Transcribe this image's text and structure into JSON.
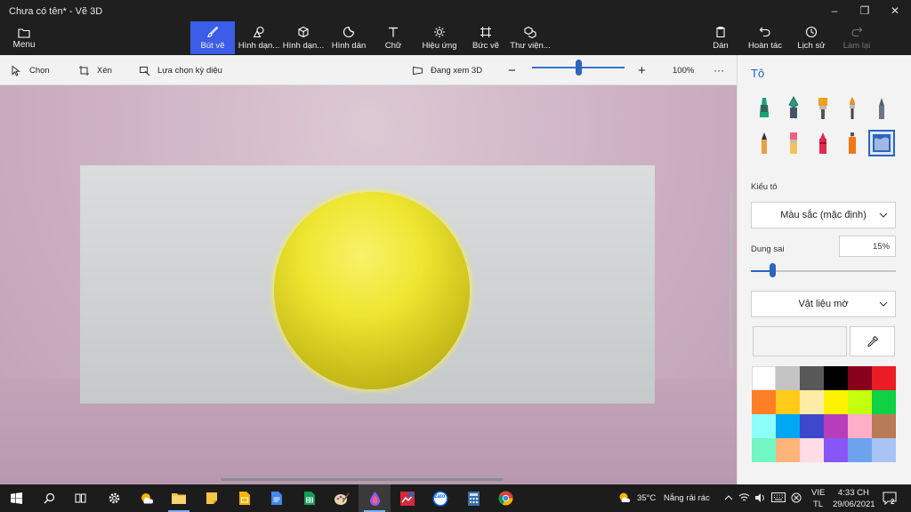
{
  "app": {
    "title": "Chưa có tên* - Vẽ 3D"
  },
  "window_controls": {
    "minimize": "–",
    "maximize": "❐",
    "close": "✕"
  },
  "ribbon": {
    "menu_label": "Menu",
    "tools": [
      {
        "label": "Bút vẽ",
        "icon": "brush-icon",
        "active": true
      },
      {
        "label": "Hình dạn...",
        "icon": "2d-shapes-icon"
      },
      {
        "label": "Hình dạn...",
        "icon": "3d-shapes-icon"
      },
      {
        "label": "Hình dán",
        "icon": "stickers-icon"
      },
      {
        "label": "Chữ",
        "icon": "text-icon"
      },
      {
        "label": "Hiệu ứng",
        "icon": "effects-icon"
      },
      {
        "label": "Bức vẽ",
        "icon": "canvas-icon"
      },
      {
        "label": "Thư viện...",
        "icon": "3d-library-icon"
      }
    ],
    "right_tools": [
      {
        "label": "Dán",
        "icon": "paste-icon"
      },
      {
        "label": "Hoàn tác",
        "icon": "undo-icon"
      },
      {
        "label": "Lịch sử",
        "icon": "history-icon"
      },
      {
        "label": "Làm lại",
        "icon": "redo-icon",
        "disabled": true
      }
    ]
  },
  "toolbar": {
    "select_label": "Chọn",
    "crop_label": "Xén",
    "magic_select_label": "Lựa chọn kỳ diệu",
    "view_3d_label": "Đang xem 3D",
    "zoom_out": "−",
    "zoom_in": "+",
    "zoom_level": "100%",
    "zoom_slider_fraction": 0.5,
    "more": "···"
  },
  "panel": {
    "title": "Tô",
    "brushes": [
      {
        "name": "marker",
        "color": "#1aa37a"
      },
      {
        "name": "calligraphy-pen",
        "color": "#2a9a8a"
      },
      {
        "name": "oil-brush",
        "color": "#f0a020"
      },
      {
        "name": "watercolor",
        "color": "#e89028"
      },
      {
        "name": "pixel-pen",
        "color": "#556070"
      },
      {
        "name": "pencil",
        "color": "#e8a040"
      },
      {
        "name": "eraser",
        "color": "#f06080"
      },
      {
        "name": "crayon",
        "color": "#e02850"
      },
      {
        "name": "spray-can",
        "color": "#f07818"
      },
      {
        "name": "fill",
        "color": "#2d64bf",
        "selected": true
      }
    ],
    "fill_type_label": "Kiểu tô",
    "fill_type_value": "Màu sắc (mặc định)",
    "tolerance_label": "Dung sai",
    "tolerance_value": "15%",
    "tolerance_fraction": 0.15,
    "material_value": "Vật liệu mờ",
    "swatches": [
      "#ffffff",
      "#c3c3c3",
      "#585858",
      "#000000",
      "#88001b",
      "#ec1c24",
      "#ff7f27",
      "#ffca18",
      "#fdeca6",
      "#fff200",
      "#c4ff0e",
      "#0ed145",
      "#8cfffb",
      "#00a8f3",
      "#3f48cc",
      "#b83dba",
      "#ffaec8",
      "#b97a56",
      "#72f7c4",
      "#ffb478",
      "#ffdce6",
      "#8855f7",
      "#6ea2ec",
      "#a8c4f5"
    ]
  },
  "colors": {
    "accent": "#3b5de7",
    "sphere": "#eee630"
  },
  "taskbar": {
    "weather_temp": "35°C",
    "weather_text": "Nắng rải rác",
    "lang_top": "VIE",
    "lang_bottom": "TL",
    "time": "4:33 CH",
    "date": "29/06/2021",
    "notification_count": "2",
    "zalo_label": "Zalo"
  }
}
